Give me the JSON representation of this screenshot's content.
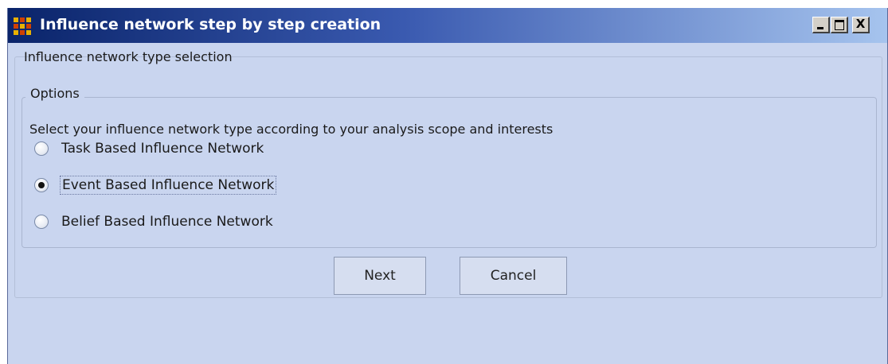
{
  "window": {
    "title": "Influence network step by step creation",
    "controls": {
      "minimize_label": "_",
      "maximize_label": "□",
      "close_label": "X"
    },
    "title_gradient": [
      "#0a246a",
      "#a6c4ee"
    ],
    "background": "#c9d5ef"
  },
  "app_icon": {
    "name": "grid-dots-icon",
    "colors": [
      "#e8b000",
      "#d04000",
      "#e8b000",
      "#d04000",
      "#e8b000",
      "#d04000",
      "#e8b000",
      "#d04000",
      "#e8b000"
    ]
  },
  "section": {
    "label": "Influence network type selection"
  },
  "options": {
    "legend": "Options",
    "instruction": "Select your influence network type according to your analysis scope and interests",
    "items": [
      {
        "label": "Task Based Influence Network",
        "selected": false
      },
      {
        "label": "Event Based Influence Network",
        "selected": true
      },
      {
        "label": "Belief Based Influence Network",
        "selected": false
      }
    ]
  },
  "buttons": {
    "next_label": "Next",
    "cancel_label": "Cancel"
  }
}
